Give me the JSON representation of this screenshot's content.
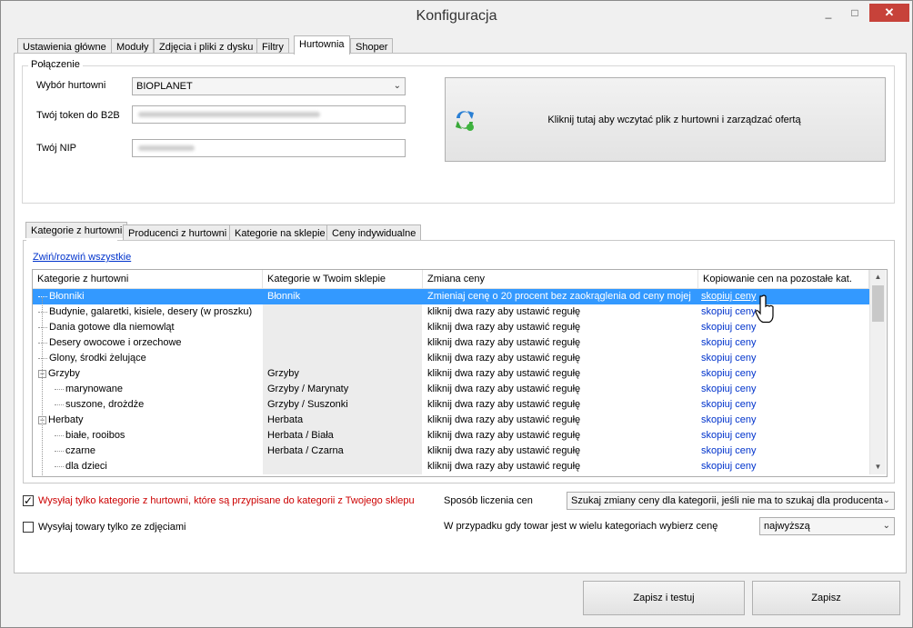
{
  "window": {
    "title": "Konfiguracja",
    "minimize": "_",
    "maximize": "□",
    "close": "✕"
  },
  "tabs": [
    "Ustawienia główne",
    "Moduły",
    "Zdjęcia i pliki z dysku",
    "Filtry",
    "Hurtownia",
    "Shoper"
  ],
  "connection": {
    "group_title": "Połączenie",
    "wholesaler_label": "Wybór hurtowni",
    "wholesaler_value": "BIOPLANET",
    "token_label": "Twój token do B2B",
    "nip_label": "Twój NIP",
    "load_button": "Kliknij tutaj aby wczytać plik z hurtowni i zarządzać ofertą",
    "load_icon": "refresh-sync-icon"
  },
  "subtabs": [
    "Kategorie z hurtowni",
    "Producenci z hurtowni",
    "Kategorie na sklepie",
    "Ceny indywidualne"
  ],
  "collapse_link": "Zwiń/rozwiń wszystkie",
  "grid": {
    "headers": [
      "Kategorie z hurtowni",
      "Kategorie w Twoim sklepie",
      "Zmiana ceny",
      "Kopiowanie cen na pozostałe kat."
    ],
    "rows": [
      {
        "cat": "Błonniki",
        "shop": "Błonnik",
        "price": "Zmieniaj cenę o 20 procent bez zaokrąglenia od ceny mojej",
        "copy": "skopiuj ceny",
        "level": 0,
        "expander": "",
        "selected": true
      },
      {
        "cat": "Budynie, galaretki, kisiele, desery (w proszku)",
        "shop": "",
        "price": "kliknij dwa razy aby ustawić regułę",
        "copy": "skopiuj ceny",
        "level": 0,
        "expander": ""
      },
      {
        "cat": "Dania gotowe dla niemowląt",
        "shop": "",
        "price": "kliknij dwa razy aby ustawić regułę",
        "copy": "skopiuj ceny",
        "level": 0,
        "expander": ""
      },
      {
        "cat": "Desery owocowe i orzechowe",
        "shop": "",
        "price": "kliknij dwa razy aby ustawić regułę",
        "copy": "skopiuj ceny",
        "level": 0,
        "expander": ""
      },
      {
        "cat": "Glony, środki żelujące",
        "shop": "",
        "price": "kliknij dwa razy aby ustawić regułę",
        "copy": "skopiuj ceny",
        "level": 0,
        "expander": ""
      },
      {
        "cat": "Grzyby",
        "shop": "Grzyby",
        "price": "kliknij dwa razy aby ustawić regułę",
        "copy": "skopiuj ceny",
        "level": 0,
        "expander": "−"
      },
      {
        "cat": "marynowane",
        "shop": "Grzyby / Marynaty",
        "price": "kliknij dwa razy aby ustawić regułę",
        "copy": "skopiuj ceny",
        "level": 1,
        "expander": ""
      },
      {
        "cat": "suszone, drożdże",
        "shop": "Grzyby / Suszonki",
        "price": "kliknij dwa razy aby ustawić regułę",
        "copy": "skopiuj ceny",
        "level": 1,
        "expander": ""
      },
      {
        "cat": "Herbaty",
        "shop": "Herbata",
        "price": "kliknij dwa razy aby ustawić regułę",
        "copy": "skopiuj ceny",
        "level": 0,
        "expander": "−"
      },
      {
        "cat": "białe, rooibos",
        "shop": "Herbata / Biała",
        "price": "kliknij dwa razy aby ustawić regułę",
        "copy": "skopiuj ceny",
        "level": 1,
        "expander": ""
      },
      {
        "cat": "czarne",
        "shop": "Herbata / Czarna",
        "price": "kliknij dwa razy aby ustawić regułę",
        "copy": "skopiuj ceny",
        "level": 1,
        "expander": ""
      },
      {
        "cat": "dla dzieci",
        "shop": "",
        "price": "kliknij dwa razy aby ustawić regułę",
        "copy": "skopiuj ceny",
        "level": 1,
        "expander": ""
      }
    ]
  },
  "options": {
    "send_only_mapped": "Wysyłaj tylko kategorie z hurtowni, które są przypisane do kategorii z Twojego sklepu",
    "send_only_mapped_checked": true,
    "send_with_photos": "Wysyłaj towary tylko ze zdjęciami",
    "send_with_photos_checked": false,
    "price_method_label": "Sposób liczenia cen",
    "price_method_value": "Szukaj zmiany ceny dla kategorii, jeśli nie ma to szukaj dla producenta",
    "multi_cat_label": "W przypadku gdy towar jest w wielu kategoriach wybierz cenę",
    "multi_cat_value": "najwyższą"
  },
  "footer": {
    "save_test": "Zapisz i testuj",
    "save": "Zapisz"
  },
  "colors": {
    "selection": "#3399ff",
    "link": "#0033cc",
    "close": "#c7423a",
    "warning_text": "#cc0000"
  }
}
